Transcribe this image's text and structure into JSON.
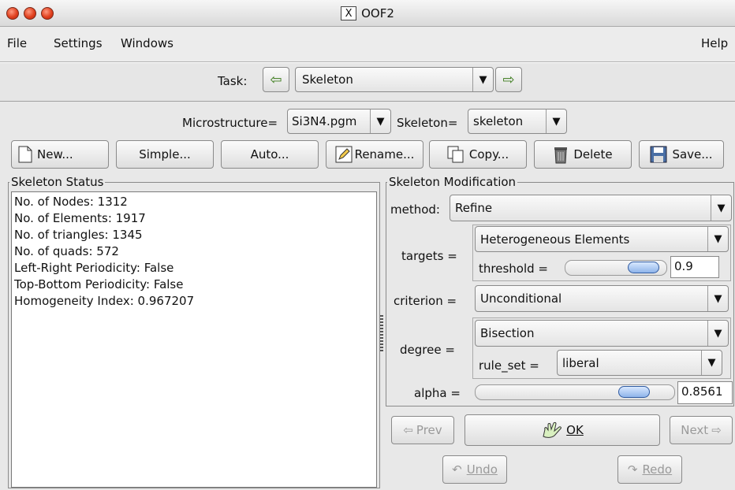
{
  "window": {
    "title": "OOF2",
    "x_label": "X"
  },
  "menubar": {
    "items": [
      "File",
      "Settings",
      "Windows"
    ],
    "help": "Help"
  },
  "task": {
    "label": "Task:",
    "value": "Skeleton"
  },
  "selectors": {
    "microstructure_label": "Microstructure=",
    "microstructure_value": "Si3N4.pgm",
    "skeleton_label": "Skeleton=",
    "skeleton_value": "skeleton"
  },
  "toolbar": {
    "new": "New...",
    "simple": "Simple...",
    "auto": "Auto...",
    "rename": "Rename...",
    "copy": "Copy...",
    "delete": "Delete",
    "save": "Save..."
  },
  "status": {
    "title": "Skeleton Status",
    "lines": [
      "No. of Nodes: 1312",
      "No. of Elements: 1917",
      "No. of triangles: 1345",
      "No. of quads: 572",
      "Left-Right Periodicity: False",
      "Top-Bottom Periodicity: False",
      "Homogeneity Index: 0.967207"
    ]
  },
  "modification": {
    "title": "Skeleton Modification",
    "method_label": "method:",
    "method_value": "Refine",
    "targets_label": "targets =",
    "targets_value": "Heterogeneous Elements",
    "threshold_label": "threshold =",
    "threshold_value": "0.9",
    "threshold_fraction": 0.9,
    "criterion_label": "criterion =",
    "criterion_value": "Unconditional",
    "degree_label": "degree =",
    "degree_value": "Bisection",
    "rule_set_label": "rule_set =",
    "rule_set_value": "liberal",
    "alpha_label": "alpha =",
    "alpha_value": "0.8561",
    "alpha_fraction": 0.8561
  },
  "actions": {
    "prev": "Prev",
    "ok": "OK",
    "next": "Next",
    "undo": "Undo",
    "redo": "Redo"
  },
  "colors": {
    "slider_knob": "#8fb4ea",
    "title_light": "#e0401e"
  }
}
